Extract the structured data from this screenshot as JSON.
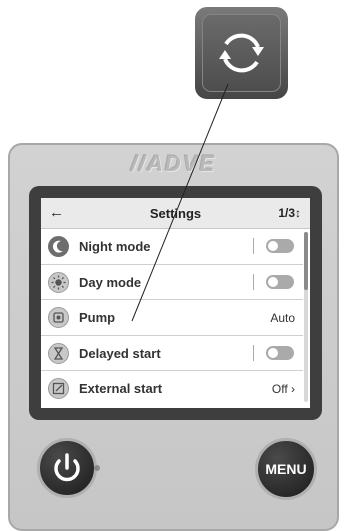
{
  "brand": {
    "name": "//ADVE"
  },
  "screen": {
    "back_icon": "arrow-left-icon",
    "title": "Settings",
    "page_indicator": "1/3↕"
  },
  "settings": {
    "items": [
      {
        "label": "Night mode",
        "icon": "moon-icon",
        "control": "toggle",
        "value": "off"
      },
      {
        "label": "Day mode",
        "icon": "sun-icon",
        "control": "toggle",
        "value": "off"
      },
      {
        "label": "Pump",
        "icon": "pump-icon",
        "control": "value",
        "value": "Auto"
      },
      {
        "label": "Delayed start",
        "icon": "hourglass-icon",
        "control": "toggle",
        "value": "off"
      },
      {
        "label": "External start",
        "icon": "external-start-icon",
        "control": "value",
        "value": "Off ›"
      }
    ]
  },
  "buttons": {
    "power_icon": "power-icon",
    "menu_label": "MENU"
  },
  "callout": {
    "icon": "refresh-icon"
  },
  "colors": {
    "device_body": "#c9c9c9",
    "bezel": "#3e3e3e",
    "header": "#eaeaea",
    "button": "#1f1f1f",
    "toggle_off": "#aaaaaa"
  }
}
